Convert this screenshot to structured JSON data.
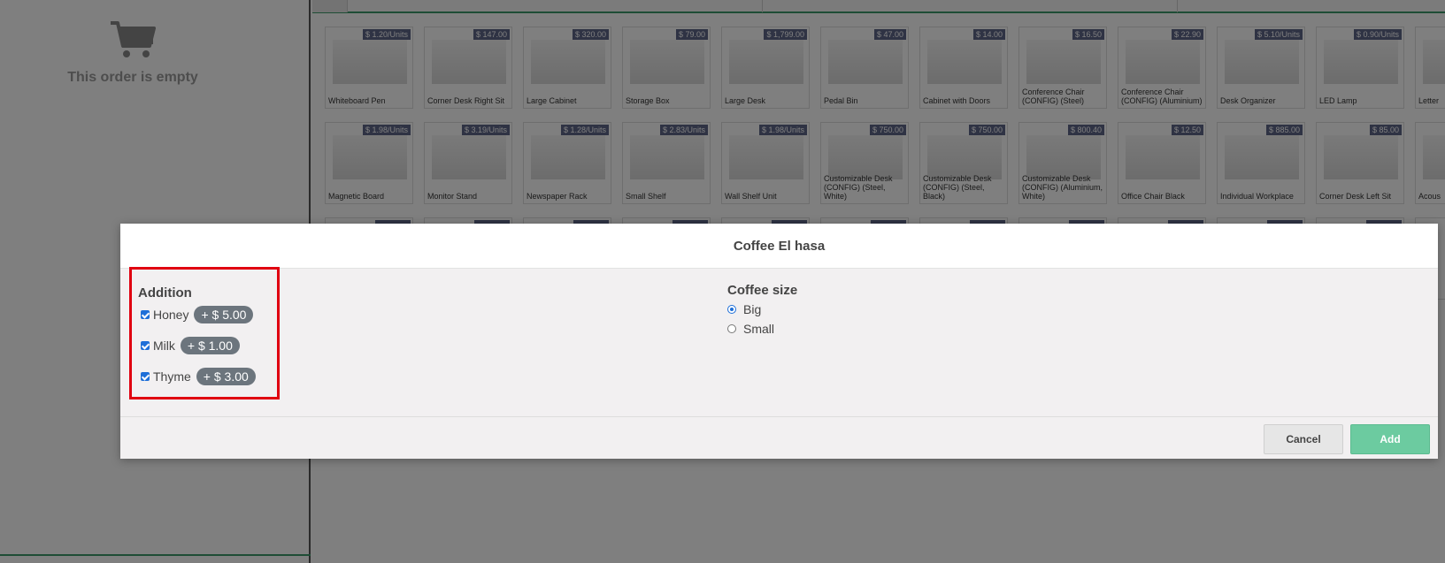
{
  "order": {
    "empty_text": "This order is empty",
    "cart_icon": "cart-icon"
  },
  "products": {
    "row1": [
      {
        "price": "$ 1.20/Units",
        "name": "Whiteboard Pen"
      },
      {
        "price": "$ 147.00",
        "name": "Corner Desk Right Sit"
      },
      {
        "price": "$ 320.00",
        "name": "Large Cabinet"
      },
      {
        "price": "$ 79.00",
        "name": "Storage Box"
      },
      {
        "price": "$ 1,799.00",
        "name": "Large Desk"
      },
      {
        "price": "$ 47.00",
        "name": "Pedal Bin"
      },
      {
        "price": "$ 14.00",
        "name": "Cabinet with Doors"
      },
      {
        "price": "$ 16.50",
        "name": "Conference Chair (CONFIG) (Steel)"
      },
      {
        "price": "$ 22.90",
        "name": "Conference Chair (CONFIG) (Aluminium)"
      },
      {
        "price": "$ 5.10/Units",
        "name": "Desk Organizer"
      },
      {
        "price": "$ 0.90/Units",
        "name": "LED Lamp"
      },
      {
        "price": "",
        "name": "Letter"
      }
    ],
    "row2": [
      {
        "price": "$ 1.98/Units",
        "name": "Magnetic Board"
      },
      {
        "price": "$ 3.19/Units",
        "name": "Monitor Stand"
      },
      {
        "price": "$ 1.28/Units",
        "name": "Newspaper Rack"
      },
      {
        "price": "$ 2.83/Units",
        "name": "Small Shelf"
      },
      {
        "price": "$ 1.98/Units",
        "name": "Wall Shelf Unit"
      },
      {
        "price": "$ 750.00",
        "name": "Customizable Desk (CONFIG) (Steel, White)"
      },
      {
        "price": "$ 750.00",
        "name": "Customizable Desk (CONFIG) (Steel, Black)"
      },
      {
        "price": "$ 800.40",
        "name": "Customizable Desk (CONFIG) (Aluminium, White)"
      },
      {
        "price": "$ 12.50",
        "name": "Office Chair Black"
      },
      {
        "price": "$ 885.00",
        "name": "Individual Workplace"
      },
      {
        "price": "$ 85.00",
        "name": "Corner Desk Left Sit"
      },
      {
        "price": "",
        "name": "Acous"
      }
    ]
  },
  "modal": {
    "title": "Coffee El hasa",
    "addition_title": "Addition",
    "additions": [
      {
        "label": "Honey",
        "price": "+ $ 5.00",
        "checked": true
      },
      {
        "label": "Milk",
        "price": "+ $ 1.00",
        "checked": true
      },
      {
        "label": "Thyme",
        "price": "+ $ 3.00",
        "checked": true
      }
    ],
    "size_title": "Coffee size",
    "sizes": [
      {
        "label": "Big",
        "selected": true
      },
      {
        "label": "Small",
        "selected": false
      }
    ],
    "cancel_label": "Cancel",
    "add_label": "Add"
  },
  "colors": {
    "price_badge": "#5e6689",
    "highlight_border": "#e00010",
    "add_button": "#6ccba0",
    "accent_green": "#3d9a6b"
  }
}
